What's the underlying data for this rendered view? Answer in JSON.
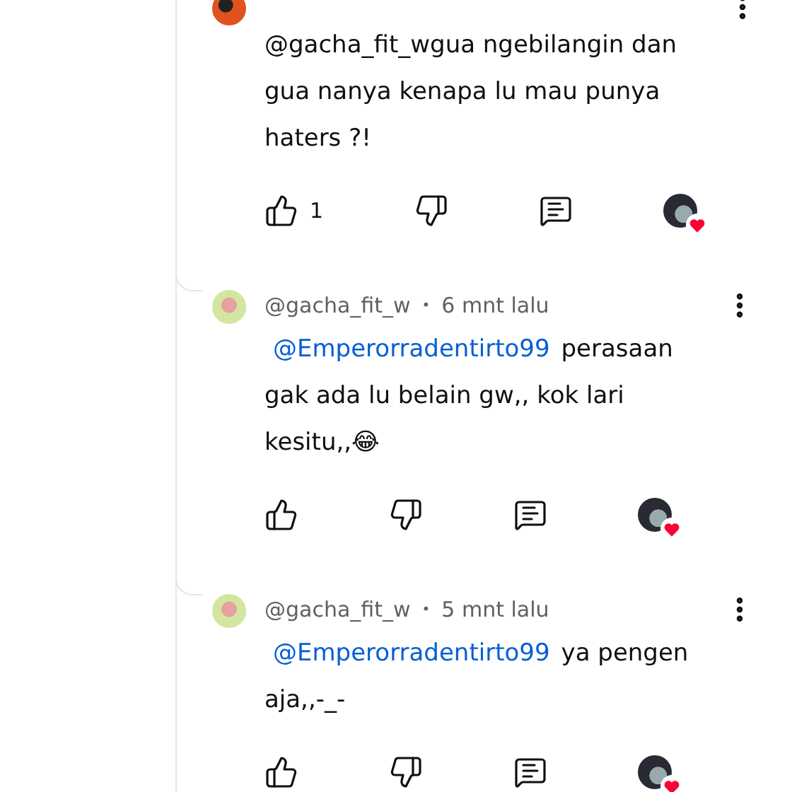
{
  "comments": [
    {
      "kind": "comment",
      "body": "@gacha_fit_wgua ngebilangin dan gua nanya kenapa lu mau punya haters ?!",
      "likes": "1",
      "hearted": true
    },
    {
      "kind": "reply",
      "author": "@gacha_fit_w",
      "separator": "•",
      "time": "6 mnt lalu",
      "mention": "@Emperorradentirto99",
      "body": "perasaan gak ada lu belain gw,, kok lari kesitu,,😂",
      "hearted": true
    },
    {
      "kind": "reply",
      "author": "@gacha_fit_w",
      "separator": "•",
      "time": "5 mnt lalu",
      "mention": "@Emperorradentirto99",
      "body": "ya pengen aja,,-_-",
      "hearted": true
    }
  ]
}
